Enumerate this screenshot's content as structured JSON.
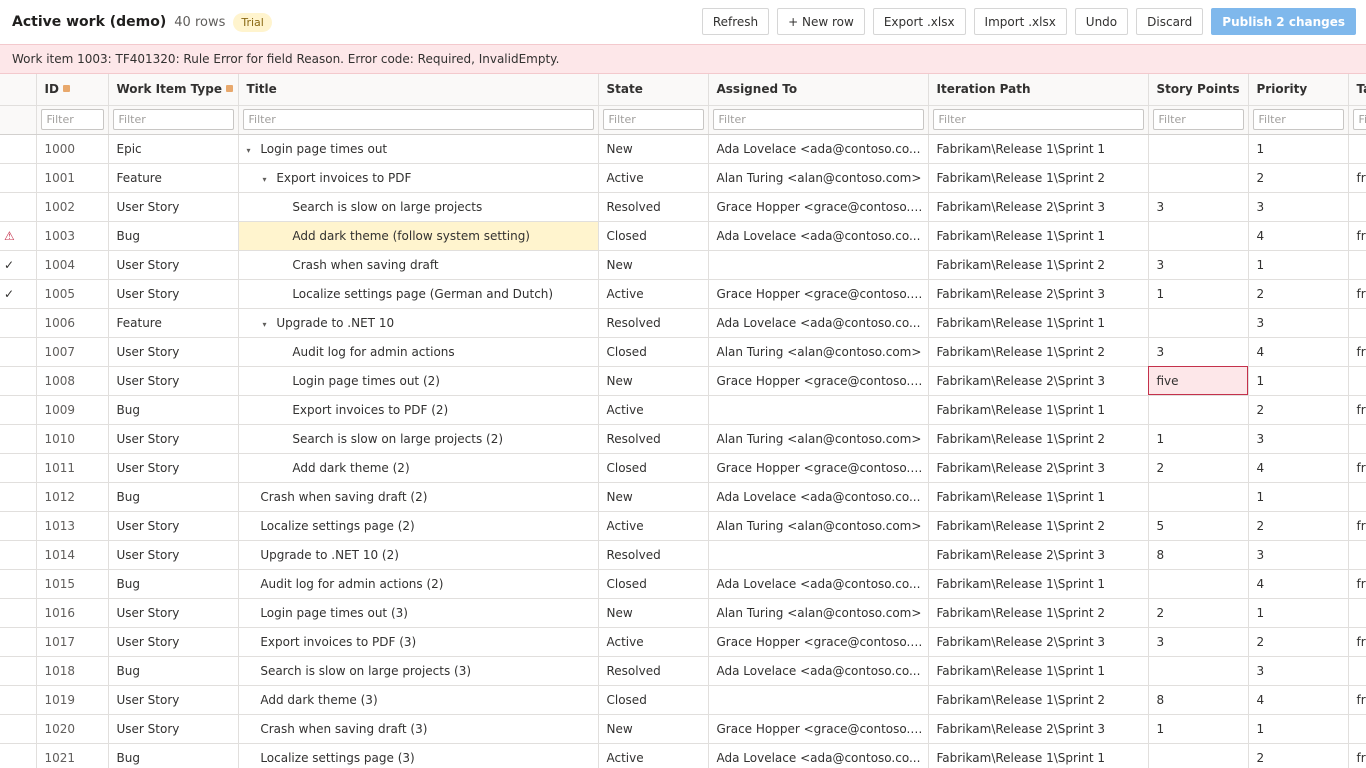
{
  "header": {
    "title": "Active work (demo)",
    "row_count": "40 rows",
    "badge": "Trial"
  },
  "toolbar": {
    "refresh": "Refresh",
    "new_row": "+ New row",
    "export": "Export .xlsx",
    "import": "Import .xlsx",
    "undo": "Undo",
    "discard": "Discard",
    "publish": "Publish 2 changes"
  },
  "banner": {
    "message": "Work item 1003: TF401320: Rule Error for field Reason. Error code: Required, InvalidEmpty."
  },
  "columns": [
    {
      "key": "id",
      "label": "ID",
      "locked": true
    },
    {
      "key": "type",
      "label": "Work Item Type",
      "locked": true
    },
    {
      "key": "title",
      "label": "Title",
      "locked": false
    },
    {
      "key": "state",
      "label": "State",
      "locked": false
    },
    {
      "key": "assigned",
      "label": "Assigned To",
      "locked": false
    },
    {
      "key": "iteration",
      "label": "Iteration Path",
      "locked": false
    },
    {
      "key": "points",
      "label": "Story Points",
      "locked": false
    },
    {
      "key": "priority",
      "label": "Priority",
      "locked": false
    },
    {
      "key": "tags",
      "label": "Ta",
      "locked": false
    }
  ],
  "filter_placeholder": "Filter",
  "icons": {
    "warning": "warning-icon",
    "check": "check-icon",
    "lock": "lock-icon",
    "twisty": "caret-down-icon"
  },
  "rows": [
    {
      "mark": "",
      "id": "1000",
      "type": "Epic",
      "indent": 0,
      "twisty": true,
      "title": "Login page times out",
      "state": "New",
      "assigned": "Ada Lovelace <ada@contoso.co...",
      "iteration": "Fabrikam\\Release 1\\Sprint 1",
      "points": "",
      "priority": "1",
      "tags": ""
    },
    {
      "mark": "",
      "id": "1001",
      "type": "Feature",
      "indent": 1,
      "twisty": true,
      "title": "Export invoices to PDF",
      "state": "Active",
      "assigned": "Alan Turing <alan@contoso.com>",
      "iteration": "Fabrikam\\Release 1\\Sprint 2",
      "points": "",
      "priority": "2",
      "tags": "fr"
    },
    {
      "mark": "",
      "id": "1002",
      "type": "User Story",
      "indent": 2,
      "twisty": false,
      "title": "Search is slow on large projects",
      "state": "Resolved",
      "assigned": "Grace Hopper <grace@contoso.c...",
      "iteration": "Fabrikam\\Release 2\\Sprint 3",
      "points": "3",
      "priority": "3",
      "tags": ""
    },
    {
      "mark": "warning",
      "id": "1003",
      "type": "Bug",
      "indent": 2,
      "twisty": false,
      "title": "Add dark theme (follow system setting)",
      "state": "Closed",
      "assigned": "Ada Lovelace <ada@contoso.co...",
      "iteration": "Fabrikam\\Release 1\\Sprint 1",
      "points": "",
      "priority": "4",
      "tags": "fr",
      "title_selected": true
    },
    {
      "mark": "check",
      "id": "1004",
      "type": "User Story",
      "indent": 2,
      "twisty": false,
      "title": "Crash when saving draft",
      "state": "New",
      "assigned": "",
      "iteration": "Fabrikam\\Release 1\\Sprint 2",
      "points": "3",
      "priority": "1",
      "tags": ""
    },
    {
      "mark": "check",
      "id": "1005",
      "type": "User Story",
      "indent": 2,
      "twisty": false,
      "title": "Localize settings page (German and Dutch)",
      "state": "Active",
      "assigned": "Grace Hopper <grace@contoso.c...",
      "iteration": "Fabrikam\\Release 2\\Sprint 3",
      "points": "1",
      "priority": "2",
      "tags": "fr"
    },
    {
      "mark": "",
      "id": "1006",
      "type": "Feature",
      "indent": 1,
      "twisty": true,
      "title": "Upgrade to .NET 10",
      "state": "Resolved",
      "assigned": "Ada Lovelace <ada@contoso.co...",
      "iteration": "Fabrikam\\Release 1\\Sprint 1",
      "points": "",
      "priority": "3",
      "tags": ""
    },
    {
      "mark": "",
      "id": "1007",
      "type": "User Story",
      "indent": 2,
      "twisty": false,
      "title": "Audit log for admin actions",
      "state": "Closed",
      "assigned": "Alan Turing <alan@contoso.com>",
      "iteration": "Fabrikam\\Release 1\\Sprint 2",
      "points": "3",
      "priority": "4",
      "tags": "fr"
    },
    {
      "mark": "",
      "id": "1008",
      "type": "User Story",
      "indent": 2,
      "twisty": false,
      "title": "Login page times out (2)",
      "state": "New",
      "assigned": "Grace Hopper <grace@contoso.c...",
      "iteration": "Fabrikam\\Release 2\\Sprint 3",
      "points": "five",
      "priority": "1",
      "tags": "",
      "points_error": true
    },
    {
      "mark": "",
      "id": "1009",
      "type": "Bug",
      "indent": 2,
      "twisty": false,
      "title": "Export invoices to PDF (2)",
      "state": "Active",
      "assigned": "",
      "iteration": "Fabrikam\\Release 1\\Sprint 1",
      "points": "",
      "priority": "2",
      "tags": "fr"
    },
    {
      "mark": "",
      "id": "1010",
      "type": "User Story",
      "indent": 2,
      "twisty": false,
      "title": "Search is slow on large projects (2)",
      "state": "Resolved",
      "assigned": "Alan Turing <alan@contoso.com>",
      "iteration": "Fabrikam\\Release 1\\Sprint 2",
      "points": "1",
      "priority": "3",
      "tags": ""
    },
    {
      "mark": "",
      "id": "1011",
      "type": "User Story",
      "indent": 2,
      "twisty": false,
      "title": "Add dark theme (2)",
      "state": "Closed",
      "assigned": "Grace Hopper <grace@contoso.c...",
      "iteration": "Fabrikam\\Release 2\\Sprint 3",
      "points": "2",
      "priority": "4",
      "tags": "fr"
    },
    {
      "mark": "",
      "id": "1012",
      "type": "Bug",
      "indent": 0,
      "twisty": false,
      "title": "Crash when saving draft (2)",
      "state": "New",
      "assigned": "Ada Lovelace <ada@contoso.co...",
      "iteration": "Fabrikam\\Release 1\\Sprint 1",
      "points": "",
      "priority": "1",
      "tags": ""
    },
    {
      "mark": "",
      "id": "1013",
      "type": "User Story",
      "indent": 0,
      "twisty": false,
      "title": "Localize settings page (2)",
      "state": "Active",
      "assigned": "Alan Turing <alan@contoso.com>",
      "iteration": "Fabrikam\\Release 1\\Sprint 2",
      "points": "5",
      "priority": "2",
      "tags": "fr"
    },
    {
      "mark": "",
      "id": "1014",
      "type": "User Story",
      "indent": 0,
      "twisty": false,
      "title": "Upgrade to .NET 10 (2)",
      "state": "Resolved",
      "assigned": "",
      "iteration": "Fabrikam\\Release 2\\Sprint 3",
      "points": "8",
      "priority": "3",
      "tags": ""
    },
    {
      "mark": "",
      "id": "1015",
      "type": "Bug",
      "indent": 0,
      "twisty": false,
      "title": "Audit log for admin actions (2)",
      "state": "Closed",
      "assigned": "Ada Lovelace <ada@contoso.co...",
      "iteration": "Fabrikam\\Release 1\\Sprint 1",
      "points": "",
      "priority": "4",
      "tags": "fr"
    },
    {
      "mark": "",
      "id": "1016",
      "type": "User Story",
      "indent": 0,
      "twisty": false,
      "title": "Login page times out (3)",
      "state": "New",
      "assigned": "Alan Turing <alan@contoso.com>",
      "iteration": "Fabrikam\\Release 1\\Sprint 2",
      "points": "2",
      "priority": "1",
      "tags": ""
    },
    {
      "mark": "",
      "id": "1017",
      "type": "User Story",
      "indent": 0,
      "twisty": false,
      "title": "Export invoices to PDF (3)",
      "state": "Active",
      "assigned": "Grace Hopper <grace@contoso.c...",
      "iteration": "Fabrikam\\Release 2\\Sprint 3",
      "points": "3",
      "priority": "2",
      "tags": "fr"
    },
    {
      "mark": "",
      "id": "1018",
      "type": "Bug",
      "indent": 0,
      "twisty": false,
      "title": "Search is slow on large projects (3)",
      "state": "Resolved",
      "assigned": "Ada Lovelace <ada@contoso.co...",
      "iteration": "Fabrikam\\Release 1\\Sprint 1",
      "points": "",
      "priority": "3",
      "tags": ""
    },
    {
      "mark": "",
      "id": "1019",
      "type": "User Story",
      "indent": 0,
      "twisty": false,
      "title": "Add dark theme (3)",
      "state": "Closed",
      "assigned": "",
      "iteration": "Fabrikam\\Release 1\\Sprint 2",
      "points": "8",
      "priority": "4",
      "tags": "fr"
    },
    {
      "mark": "",
      "id": "1020",
      "type": "User Story",
      "indent": 0,
      "twisty": false,
      "title": "Crash when saving draft (3)",
      "state": "New",
      "assigned": "Grace Hopper <grace@contoso.c...",
      "iteration": "Fabrikam\\Release 2\\Sprint 3",
      "points": "1",
      "priority": "1",
      "tags": ""
    },
    {
      "mark": "",
      "id": "1021",
      "type": "Bug",
      "indent": 0,
      "twisty": false,
      "title": "Localize settings page (3)",
      "state": "Active",
      "assigned": "Ada Lovelace <ada@contoso.co...",
      "iteration": "Fabrikam\\Release 1\\Sprint 1",
      "points": "",
      "priority": "2",
      "tags": "fr"
    }
  ]
}
